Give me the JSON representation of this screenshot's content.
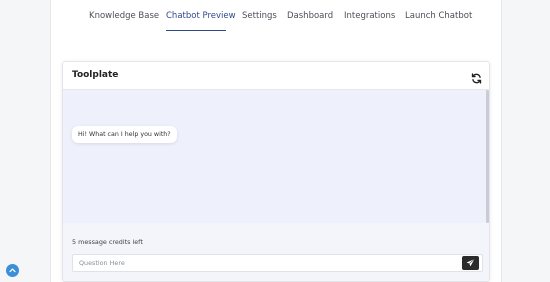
{
  "nav": {
    "tabs": [
      {
        "label": "Knowledge Base",
        "active": false
      },
      {
        "label": "Chatbot Preview",
        "active": true
      },
      {
        "label": "Settings",
        "active": false
      },
      {
        "label": "Dashboard",
        "active": false
      },
      {
        "label": "Integrations",
        "active": false
      },
      {
        "label": "Launch Chatbot",
        "active": false
      }
    ]
  },
  "chat": {
    "title": "Toolplate",
    "refresh_icon": "refresh-icon",
    "messages": [
      {
        "from": "bot",
        "text": "Hi! What can I help you with?"
      }
    ],
    "credits_text": "5 message credits left",
    "input": {
      "value": "",
      "placeholder": "Question Here"
    },
    "send_icon": "send-icon"
  },
  "widget": {
    "icon": "chevron-up-icon"
  },
  "colors": {
    "accent": "#2f4a8a",
    "chat_background": "#eef0fb",
    "send_button": "#2b2b2b",
    "fab": "#3a8fd8"
  }
}
